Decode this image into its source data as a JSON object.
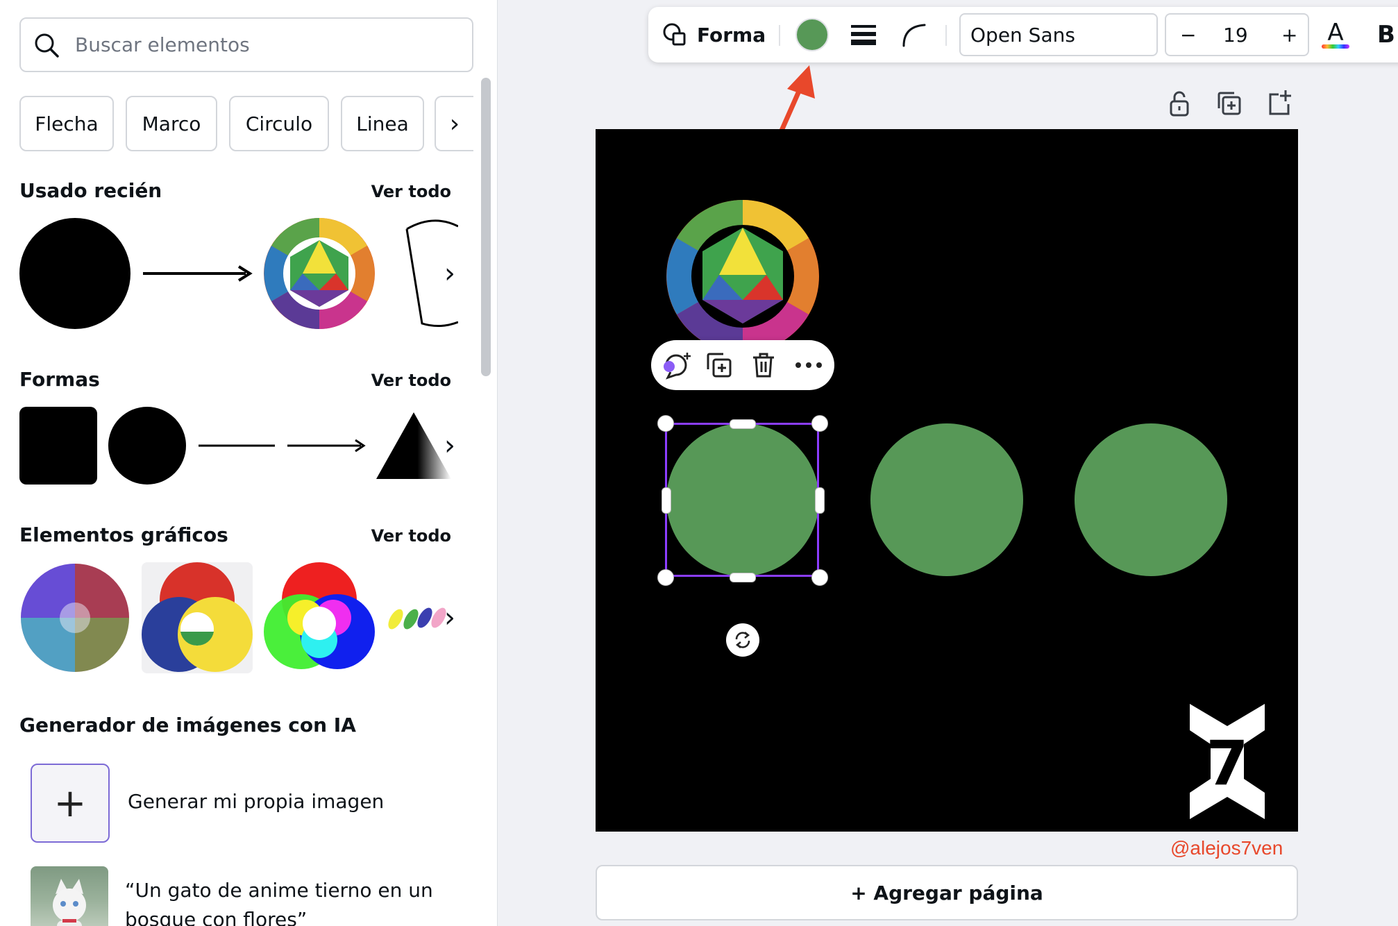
{
  "search": {
    "placeholder": "Buscar elementos"
  },
  "chips": [
    "Flecha",
    "Marco",
    "Circulo",
    "Linea"
  ],
  "sections": {
    "recent": {
      "title": "Usado recién",
      "see_all": "Ver todo"
    },
    "shapes": {
      "title": "Formas",
      "see_all": "Ver todo"
    },
    "graphics": {
      "title": "Elementos gráficos",
      "see_all": "Ver todo"
    },
    "ai": {
      "title": "Generador de imágenes con IA",
      "generate_label": "Generar mi propia imagen",
      "prompt_example": "“Un gato de anime tierno en un bosque con flores”"
    }
  },
  "toolbar": {
    "shape_label": "Forma",
    "fill_color": "#579857",
    "font_name": "Open Sans",
    "font_size": "19",
    "minus": "−",
    "plus": "+",
    "bold": "B",
    "text_color_letter": "A"
  },
  "canvas": {
    "background": "#000000",
    "circle_color": "#579857",
    "watermark": "@alejos7ven",
    "logo_text": "7"
  },
  "add_page_label": "+ Agregar página",
  "colors": {
    "accent": "#8b3dff",
    "arrow": "#e8482b"
  }
}
